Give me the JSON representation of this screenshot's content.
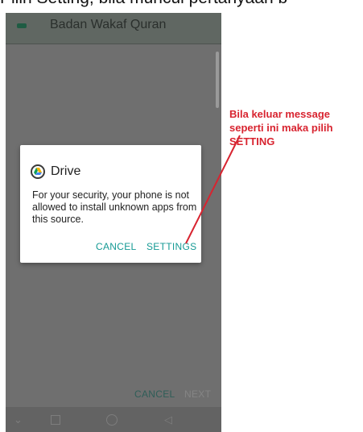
{
  "caption": {
    "text": "Pilih Setting, bila muncul pertanyaan b"
  },
  "app_bar": {
    "title": "Badan Wakaf Quran"
  },
  "background_buttons": {
    "cancel": "CANCEL",
    "next": "NEXT"
  },
  "dialog": {
    "app_name": "Drive",
    "message": "For your security, your phone is not allowed to install unknown apps from this source.",
    "cancel_label": "CANCEL",
    "settings_label": "SETTINGS"
  },
  "annotation": {
    "line1": "Bila keluar message",
    "line2": "seperti ini maka pilih",
    "line3": "SETTING",
    "color": "#d82430"
  },
  "nav_bar": {
    "icons": [
      "chevron-down-icon",
      "recents-icon",
      "home-icon",
      "back-icon"
    ]
  },
  "colors": {
    "accent": "#159a94",
    "scrim": "#6f6f6f"
  }
}
